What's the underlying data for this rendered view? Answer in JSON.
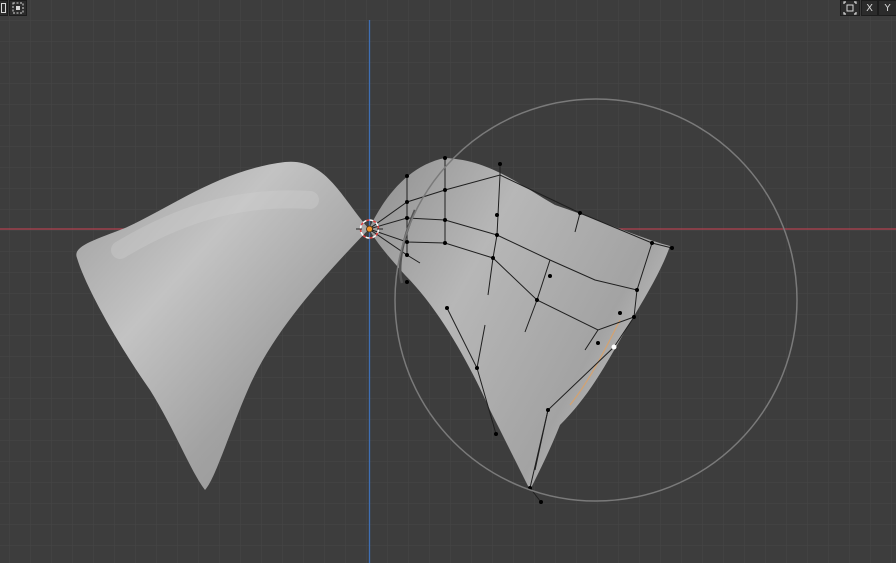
{
  "window": {
    "kind": "3D Viewport",
    "background": "#3d3d3d"
  },
  "axis_colors": {
    "x": "#b24150",
    "y": "#3f6fb4"
  },
  "mesh": {
    "base_color": "#a9a9a9",
    "edit_wire_color": "#1a1a1a",
    "vertex_color": "#000000"
  },
  "brush": {
    "cursor_color": "#7a7a7a",
    "shape": "circle"
  },
  "origin": {
    "color": "#f0932c",
    "icon": "3d-cursor-icon"
  },
  "header": {
    "left_buttons": [
      {
        "icon": "editor-type-icon"
      },
      {
        "icon": "select-box-icon"
      }
    ],
    "right_buttons": [
      {
        "icon": "gizmo-icon"
      },
      {
        "label": "X"
      },
      {
        "label": "Y"
      }
    ]
  }
}
